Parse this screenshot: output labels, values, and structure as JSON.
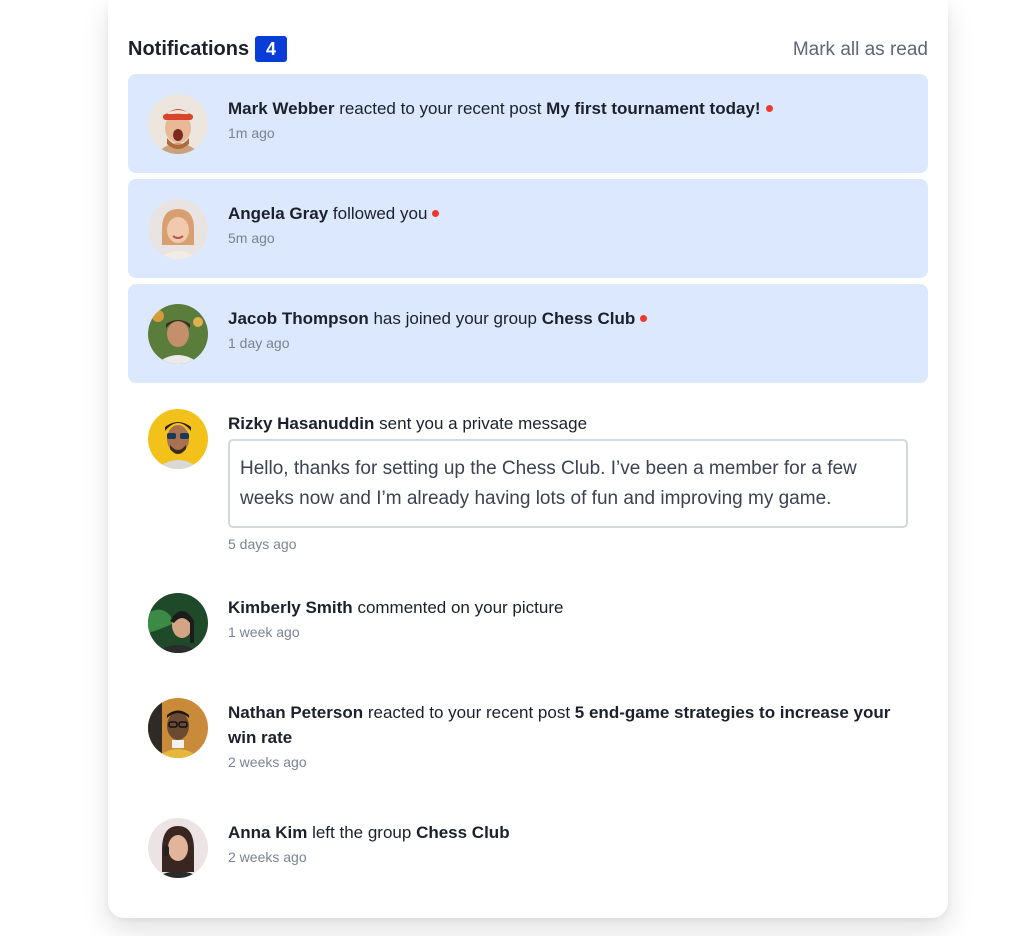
{
  "header": {
    "title": "Notifications",
    "count": "4",
    "mark_all": "Mark all as read"
  },
  "colors": {
    "accent": "#0a3dd8",
    "unread_bg": "#dbe8fd",
    "dot": "#f0372e"
  },
  "notifications": [
    {
      "name": "Mark Webber",
      "action": "reacted to your recent post",
      "target": "My first tournament today!",
      "time": "1m ago",
      "unread": true
    },
    {
      "name": "Angela Gray",
      "action": "followed you",
      "time": "5m ago",
      "unread": true
    },
    {
      "name": "Jacob Thompson",
      "action": "has joined your group",
      "target": "Chess Club",
      "time": "1 day ago",
      "unread": true
    },
    {
      "name": "Rizky Hasanuddin",
      "action": "sent you a private message",
      "message": "Hello, thanks for setting up the Chess Club. I’ve been a member for a few weeks now and I’m already having lots of fun and improving my game.",
      "time": "5 days ago",
      "unread": false
    },
    {
      "name": "Kimberly Smith",
      "action": "commented on your picture",
      "time": "1 week ago",
      "unread": false
    },
    {
      "name": "Nathan Peterson",
      "action": "reacted to your recent post",
      "target": "5 end-game strategies to increase your win rate",
      "time": "2 weeks ago",
      "unread": false
    },
    {
      "name": "Anna Kim",
      "action": "left the group",
      "target": "Chess Club",
      "time": "2 weeks ago",
      "unread": false
    }
  ]
}
